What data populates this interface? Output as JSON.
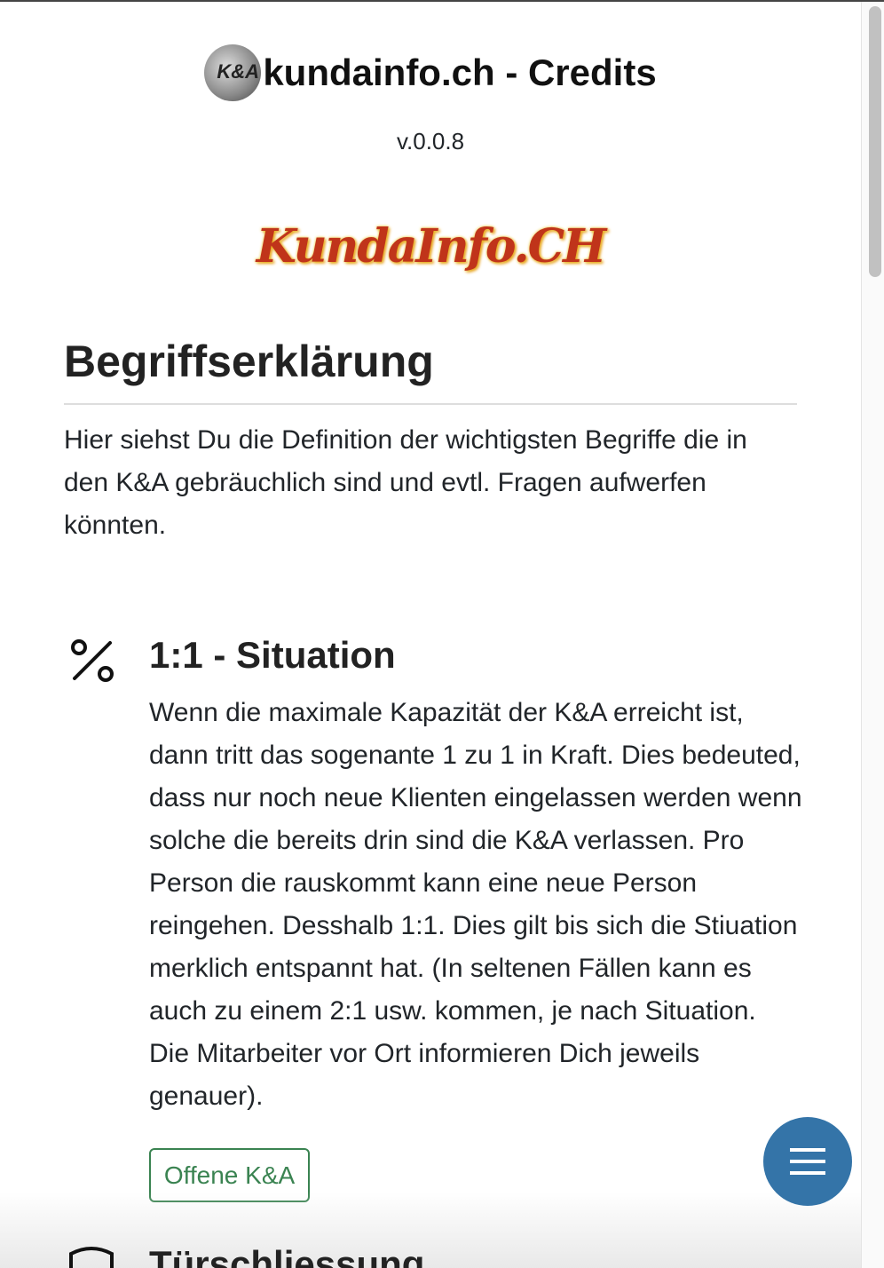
{
  "header": {
    "title": "kundainfo.ch - Credits",
    "logo_text": "K&A",
    "version": "v.0.0.8",
    "brand_logo_text": "KundaInfo.CH"
  },
  "intro": {
    "heading": "Begriffserklärung",
    "text": "Hier siehst Du die Definition der wichtigsten Begriffe die in den K&A gebräuchlich sind und evtl. Fragen aufwerfen könnten."
  },
  "sections": [
    {
      "icon": "percent-icon",
      "title": "1:1 - Situation",
      "body": "Wenn die maximale Kapazität der K&A erreicht ist, dann tritt das sogenante 1 zu 1 in Kraft. Dies bedeuted, dass nur noch neue Klienten eingelassen werden wenn solche die bereits drin sind die K&A verlassen. Pro Person die rauskommt kann eine neue Person reingehen. Desshalb 1:1. Dies gilt bis sich die Stiuation merklich entspannt hat. (In seltenen Fällen kann es auch zu einem 2:1 usw. kommen, je nach Situation. Die Mitarbeiter vor Ort informieren Dich jeweils genauer).",
      "button": "Offene K&A"
    },
    {
      "icon": "shield-icon",
      "title": "Türschliessung"
    }
  ],
  "fab": {
    "icon": "hamburger-menu-icon"
  },
  "colors": {
    "button_green": "#3a8351",
    "fab_blue": "#3474a8"
  }
}
